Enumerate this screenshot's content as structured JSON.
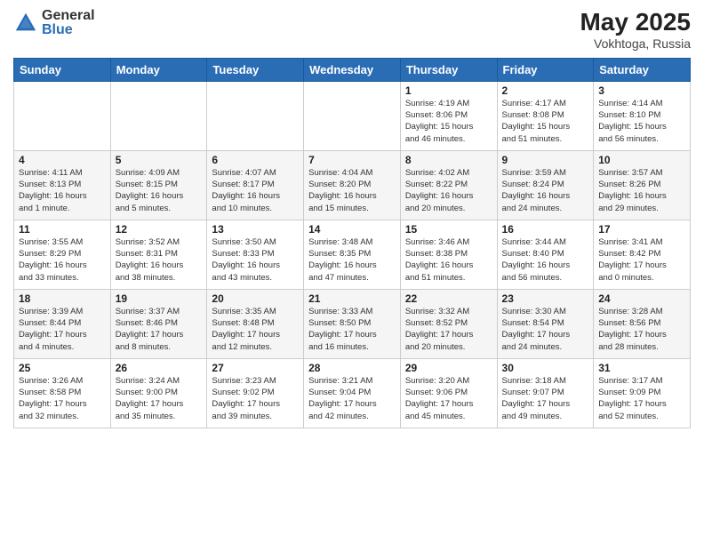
{
  "header": {
    "logo_general": "General",
    "logo_blue": "Blue",
    "month": "May 2025",
    "location": "Vokhtoga, Russia"
  },
  "weekdays": [
    "Sunday",
    "Monday",
    "Tuesday",
    "Wednesday",
    "Thursday",
    "Friday",
    "Saturday"
  ],
  "weeks": [
    [
      {
        "day": "",
        "info": ""
      },
      {
        "day": "",
        "info": ""
      },
      {
        "day": "",
        "info": ""
      },
      {
        "day": "",
        "info": ""
      },
      {
        "day": "1",
        "info": "Sunrise: 4:19 AM\nSunset: 8:06 PM\nDaylight: 15 hours\nand 46 minutes."
      },
      {
        "day": "2",
        "info": "Sunrise: 4:17 AM\nSunset: 8:08 PM\nDaylight: 15 hours\nand 51 minutes."
      },
      {
        "day": "3",
        "info": "Sunrise: 4:14 AM\nSunset: 8:10 PM\nDaylight: 15 hours\nand 56 minutes."
      }
    ],
    [
      {
        "day": "4",
        "info": "Sunrise: 4:11 AM\nSunset: 8:13 PM\nDaylight: 16 hours\nand 1 minute."
      },
      {
        "day": "5",
        "info": "Sunrise: 4:09 AM\nSunset: 8:15 PM\nDaylight: 16 hours\nand 5 minutes."
      },
      {
        "day": "6",
        "info": "Sunrise: 4:07 AM\nSunset: 8:17 PM\nDaylight: 16 hours\nand 10 minutes."
      },
      {
        "day": "7",
        "info": "Sunrise: 4:04 AM\nSunset: 8:20 PM\nDaylight: 16 hours\nand 15 minutes."
      },
      {
        "day": "8",
        "info": "Sunrise: 4:02 AM\nSunset: 8:22 PM\nDaylight: 16 hours\nand 20 minutes."
      },
      {
        "day": "9",
        "info": "Sunrise: 3:59 AM\nSunset: 8:24 PM\nDaylight: 16 hours\nand 24 minutes."
      },
      {
        "day": "10",
        "info": "Sunrise: 3:57 AM\nSunset: 8:26 PM\nDaylight: 16 hours\nand 29 minutes."
      }
    ],
    [
      {
        "day": "11",
        "info": "Sunrise: 3:55 AM\nSunset: 8:29 PM\nDaylight: 16 hours\nand 33 minutes."
      },
      {
        "day": "12",
        "info": "Sunrise: 3:52 AM\nSunset: 8:31 PM\nDaylight: 16 hours\nand 38 minutes."
      },
      {
        "day": "13",
        "info": "Sunrise: 3:50 AM\nSunset: 8:33 PM\nDaylight: 16 hours\nand 43 minutes."
      },
      {
        "day": "14",
        "info": "Sunrise: 3:48 AM\nSunset: 8:35 PM\nDaylight: 16 hours\nand 47 minutes."
      },
      {
        "day": "15",
        "info": "Sunrise: 3:46 AM\nSunset: 8:38 PM\nDaylight: 16 hours\nand 51 minutes."
      },
      {
        "day": "16",
        "info": "Sunrise: 3:44 AM\nSunset: 8:40 PM\nDaylight: 16 hours\nand 56 minutes."
      },
      {
        "day": "17",
        "info": "Sunrise: 3:41 AM\nSunset: 8:42 PM\nDaylight: 17 hours\nand 0 minutes."
      }
    ],
    [
      {
        "day": "18",
        "info": "Sunrise: 3:39 AM\nSunset: 8:44 PM\nDaylight: 17 hours\nand 4 minutes."
      },
      {
        "day": "19",
        "info": "Sunrise: 3:37 AM\nSunset: 8:46 PM\nDaylight: 17 hours\nand 8 minutes."
      },
      {
        "day": "20",
        "info": "Sunrise: 3:35 AM\nSunset: 8:48 PM\nDaylight: 17 hours\nand 12 minutes."
      },
      {
        "day": "21",
        "info": "Sunrise: 3:33 AM\nSunset: 8:50 PM\nDaylight: 17 hours\nand 16 minutes."
      },
      {
        "day": "22",
        "info": "Sunrise: 3:32 AM\nSunset: 8:52 PM\nDaylight: 17 hours\nand 20 minutes."
      },
      {
        "day": "23",
        "info": "Sunrise: 3:30 AM\nSunset: 8:54 PM\nDaylight: 17 hours\nand 24 minutes."
      },
      {
        "day": "24",
        "info": "Sunrise: 3:28 AM\nSunset: 8:56 PM\nDaylight: 17 hours\nand 28 minutes."
      }
    ],
    [
      {
        "day": "25",
        "info": "Sunrise: 3:26 AM\nSunset: 8:58 PM\nDaylight: 17 hours\nand 32 minutes."
      },
      {
        "day": "26",
        "info": "Sunrise: 3:24 AM\nSunset: 9:00 PM\nDaylight: 17 hours\nand 35 minutes."
      },
      {
        "day": "27",
        "info": "Sunrise: 3:23 AM\nSunset: 9:02 PM\nDaylight: 17 hours\nand 39 minutes."
      },
      {
        "day": "28",
        "info": "Sunrise: 3:21 AM\nSunset: 9:04 PM\nDaylight: 17 hours\nand 42 minutes."
      },
      {
        "day": "29",
        "info": "Sunrise: 3:20 AM\nSunset: 9:06 PM\nDaylight: 17 hours\nand 45 minutes."
      },
      {
        "day": "30",
        "info": "Sunrise: 3:18 AM\nSunset: 9:07 PM\nDaylight: 17 hours\nand 49 minutes."
      },
      {
        "day": "31",
        "info": "Sunrise: 3:17 AM\nSunset: 9:09 PM\nDaylight: 17 hours\nand 52 minutes."
      }
    ]
  ]
}
